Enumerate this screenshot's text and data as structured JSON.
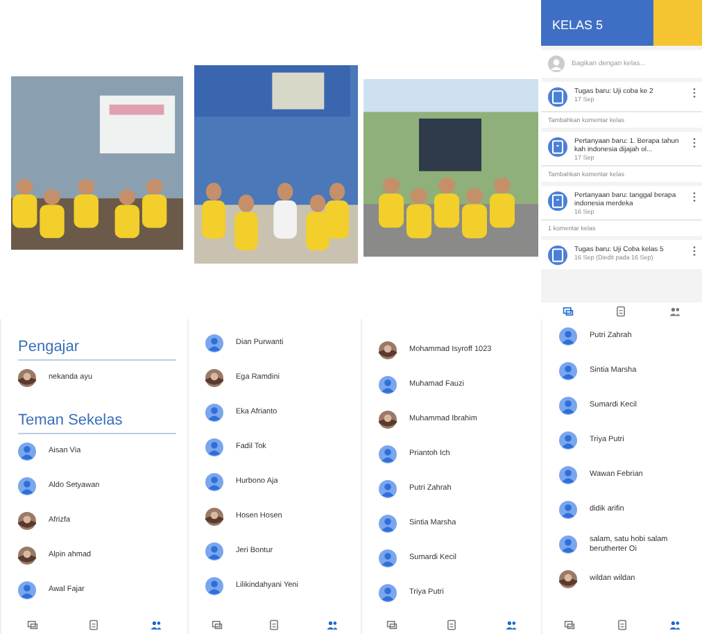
{
  "stream": {
    "class_name": "KELAS 5",
    "share_placeholder": "Bagikan dengan kelas...",
    "posts": [
      {
        "kind": "assignment",
        "title": "Tugas baru: Uji coba ke 2",
        "date": "17 Sep",
        "comment": "Tambahkan komentar kelas"
      },
      {
        "kind": "question",
        "title": "Pertanyaan baru: 1. Berapa tahun kah indonesia dijajah ol...",
        "date": "17 Sep",
        "comment": "Tambahkan komentar kelas"
      },
      {
        "kind": "question",
        "title": "Pertanyaan baru: tanggal berapa indonesia merdeka",
        "date": "16 Sep",
        "comment": "1 komentar kelas"
      },
      {
        "kind": "assignment",
        "title": "Tugas baru: Uji Coba kelas 5",
        "date": "16 Sep (Diedit pada 16 Sep)"
      }
    ],
    "nav": [
      {
        "kind": "stream",
        "selected": true
      },
      {
        "kind": "classwork",
        "selected": false
      },
      {
        "kind": "people",
        "selected": false
      }
    ]
  },
  "people_panels": [
    {
      "sections": [
        {
          "title": "Pengajar",
          "people": [
            {
              "name": "nekanda ayu"
            }
          ]
        },
        {
          "title": "Teman Sekelas",
          "people": [
            {
              "name": "Aisan Via",
              "kind": "default"
            },
            {
              "name": "Aldo Setyawan",
              "kind": "default"
            },
            {
              "name": "Afrizfa"
            },
            {
              "name": "Alpin ahmad"
            },
            {
              "name": "Awal Fajar",
              "kind": "default"
            }
          ]
        }
      ],
      "nav": [
        {
          "kind": "stream",
          "selected": false
        },
        {
          "kind": "classwork",
          "selected": false
        },
        {
          "kind": "people",
          "selected": true
        }
      ]
    },
    {
      "sections": [
        {
          "people": [
            {
              "name": "Dian Purwanti",
              "kind": "default"
            },
            {
              "name": "Ega Ramdini"
            },
            {
              "name": "Eka Afrianto",
              "kind": "default"
            },
            {
              "name": "Fadil Tok",
              "kind": "default"
            },
            {
              "name": "Hurbono Aja",
              "kind": "default"
            },
            {
              "name": "Hosen Hosen"
            },
            {
              "name": "Jeri Bontur",
              "kind": "default"
            },
            {
              "name": "Lilikindahyani Yeni",
              "kind": "default"
            }
          ]
        }
      ],
      "nav": [
        {
          "kind": "stream",
          "selected": false
        },
        {
          "kind": "classwork",
          "selected": false
        },
        {
          "kind": "people",
          "selected": true
        }
      ]
    },
    {
      "sections": [
        {
          "people": [
            {
              "name": "Mohammad Isyroff 1023"
            },
            {
              "name": "Muhamad Fauzi",
              "kind": "default"
            },
            {
              "name": "Muhammad Ibrahim"
            },
            {
              "name": "Priantoh Ich",
              "kind": "default"
            },
            {
              "name": "Putri Zahrah",
              "kind": "default"
            },
            {
              "name": "Sintia Marsha",
              "kind": "default"
            },
            {
              "name": "Sumardi Kecil",
              "kind": "default"
            },
            {
              "name": "Triya Putri",
              "kind": "default"
            }
          ]
        }
      ],
      "nav": [
        {
          "kind": "stream",
          "selected": false
        },
        {
          "kind": "classwork",
          "selected": false
        },
        {
          "kind": "people",
          "selected": true
        }
      ]
    },
    {
      "sections": [
        {
          "people": [
            {
              "name": "Putri Zahrah",
              "kind": "default"
            },
            {
              "name": "Sintia Marsha",
              "kind": "default"
            },
            {
              "name": "Sumardi Kecil",
              "kind": "default"
            },
            {
              "name": "Triya Putri",
              "kind": "default"
            },
            {
              "name": "Wawan Febrian",
              "kind": "default"
            },
            {
              "name": "didik arifin",
              "kind": "default"
            },
            {
              "name": "salam, satu hobi salam berutherter Oi",
              "kind": "default"
            },
            {
              "name": "wildan wildan"
            }
          ]
        }
      ],
      "nav": [
        {
          "kind": "stream",
          "selected": false
        },
        {
          "kind": "classwork",
          "selected": false
        },
        {
          "kind": "people",
          "selected": true
        }
      ]
    }
  ]
}
